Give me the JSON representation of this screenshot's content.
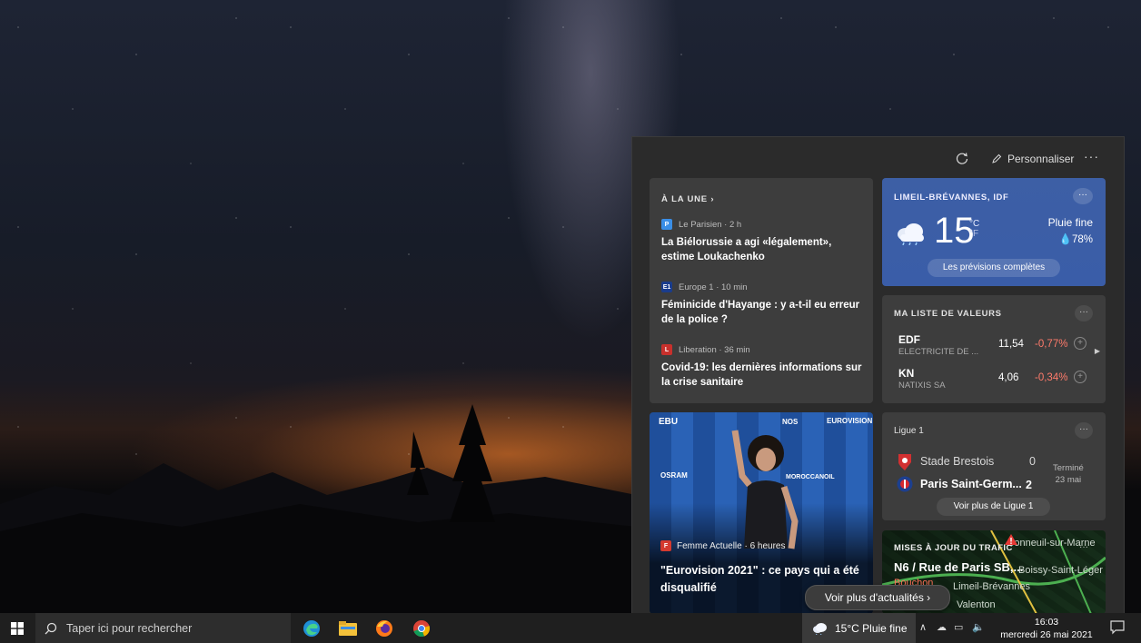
{
  "panel": {
    "personnaliser_label": "Personnaliser",
    "more": "···",
    "top_stories": {
      "header": "À LA UNE",
      "stories": [
        {
          "source": "Le Parisien · 2 h",
          "logo": "P",
          "logo_color": "#3a8ee6",
          "headline": "La Biélorussie a agi «légalement», estime Loukachenko"
        },
        {
          "source": "Europe 1 · 10 min",
          "logo": "E1",
          "logo_color": "#1a3c8c",
          "headline": "Féminicide d'Hayange : y a-t-il eu erreur de la police ?"
        },
        {
          "source": "Liberation · 36 min",
          "logo": "L",
          "logo_color": "#c8302c",
          "headline": "Covid-19: les dernières informations sur la crise sanitaire"
        }
      ]
    },
    "weather": {
      "location": "LIMEIL-BRÉVANNES, IDF",
      "more": "···",
      "temp": "15",
      "unit_c": "°C",
      "unit_f": "°F",
      "condition": "Pluie fine",
      "humidity": "78%",
      "button": "Les prévisions complètes"
    },
    "stocks": {
      "title": "MA LISTE DE VALEURS",
      "more": "···",
      "rows": [
        {
          "symbol": "EDF",
          "name": "ELECTRICITE DE ...",
          "price": "11,54",
          "change": "-0,77%"
        },
        {
          "symbol": "KN",
          "name": "NATIXIS SA",
          "price": "4,06",
          "change": "-0,34%"
        }
      ]
    },
    "image_story": {
      "logos": [
        "EBU",
        "EUROVISION",
        "OSRAM",
        "MOROCCANOIL",
        "NOS"
      ],
      "source": "Femme Actuelle · 6 heures",
      "headline": "\"Eurovision 2021\" : ce pays qui a été disqualifié"
    },
    "league": {
      "title": "Ligue 1",
      "more": "···",
      "team1": "Stade Brestois",
      "score1": "0",
      "team2": "Paris Saint-Germ...",
      "score2": "2",
      "status": "Terminé",
      "date": "23 mai",
      "button": "Voir plus de Ligue 1"
    },
    "traffic": {
      "title": "MISES À JOUR DU TRAFIC",
      "road": "N6 / Rue de Paris SB,...",
      "sub": "Bouchon",
      "places": [
        "Boissy-Saint-Léger",
        "Limeil-Brévannes",
        "Valenton",
        "Bonneuil-sur-Marne"
      ],
      "more": "···"
    },
    "see_more": "Voir plus d'actualités"
  },
  "taskbar": {
    "search_placeholder": "Taper ici pour rechercher",
    "weather": "15°C  Pluie fine",
    "time": "16:03",
    "date": "mercredi 26 mai 2021"
  },
  "colors": {
    "accent_blue": "#3d5fa5",
    "negative": "#ff7b6b",
    "card_bg": "#3d3d3d"
  }
}
